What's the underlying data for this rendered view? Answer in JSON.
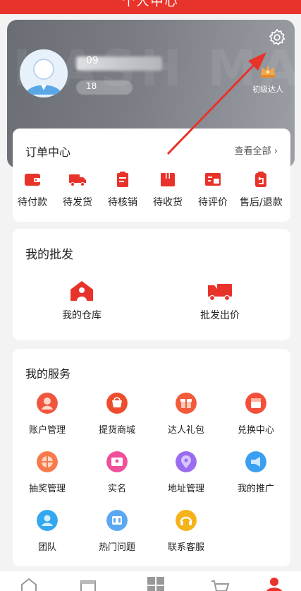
{
  "header": {
    "title": "个人中心"
  },
  "profile": {
    "name_visible": "09",
    "id_visible": "18",
    "watermark": "HASH MALL",
    "level_label": "初级达人"
  },
  "orders": {
    "title": "订单中心",
    "view_all": "查看全部",
    "items": [
      {
        "label": "待付款",
        "icon": "wallet-icon"
      },
      {
        "label": "待发货",
        "icon": "truck-icon"
      },
      {
        "label": "待核销",
        "icon": "clipboard-icon"
      },
      {
        "label": "待收货",
        "icon": "package-icon"
      },
      {
        "label": "待评价",
        "icon": "review-icon"
      },
      {
        "label": "售后/退款",
        "icon": "refund-icon"
      }
    ]
  },
  "wholesale": {
    "title": "我的批发",
    "items": [
      {
        "label": "我的仓库",
        "icon": "warehouse-icon"
      },
      {
        "label": "批发出价",
        "icon": "truck-icon"
      }
    ]
  },
  "services": {
    "title": "我的服务",
    "items": [
      {
        "label": "账户管理",
        "icon": "account-icon",
        "color": "#f0563e"
      },
      {
        "label": "提货商城",
        "icon": "mall-icon",
        "color": "#ee4d2d"
      },
      {
        "label": "达人礼包",
        "icon": "gift-icon",
        "color": "#f25a3a"
      },
      {
        "label": "兑换中心",
        "icon": "exchange-icon",
        "color": "#f2503a"
      },
      {
        "label": "抽奖管理",
        "icon": "lottery-icon",
        "color": "#f77a4a"
      },
      {
        "label": "实名",
        "icon": "id-card-icon",
        "color": "#f0509a"
      },
      {
        "label": "地址管理",
        "icon": "location-icon",
        "color": "#9b6cf0"
      },
      {
        "label": "我的推广",
        "icon": "promotion-icon",
        "color": "#3a9ff0"
      },
      {
        "label": "团队",
        "icon": "team-icon",
        "color": "#33a8f0"
      },
      {
        "label": "热门问题",
        "icon": "hot-question-icon",
        "color": "#5aa8f2"
      },
      {
        "label": "联系客服",
        "icon": "customer-service-icon",
        "color": "#f6b21a"
      }
    ]
  },
  "tabbar": {
    "items": [
      {
        "icon": "home-icon"
      },
      {
        "icon": "shop-icon"
      },
      {
        "icon": "category-icon"
      },
      {
        "icon": "cart-icon"
      },
      {
        "icon": "profile-icon"
      }
    ]
  },
  "colors": {
    "brand": "#e8332a",
    "profile_bg": "#7b7e85"
  }
}
